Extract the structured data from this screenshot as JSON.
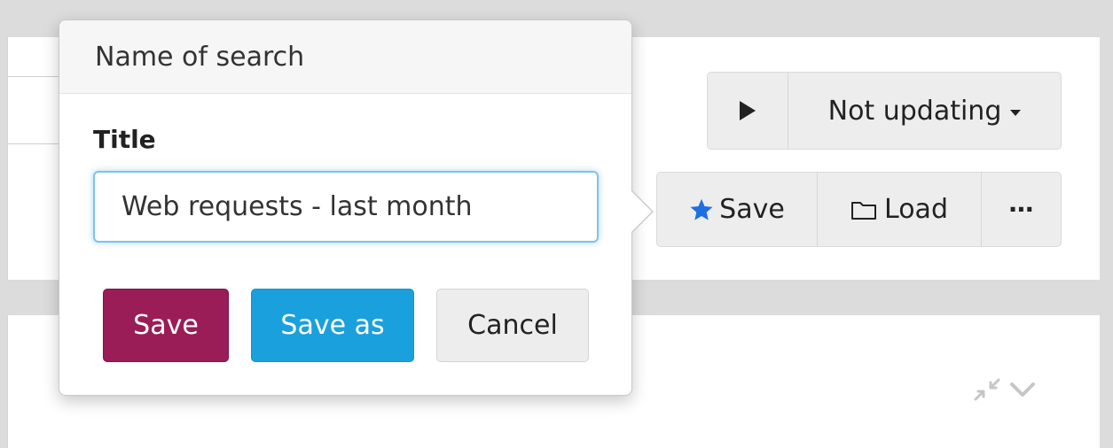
{
  "toolbar": {
    "refresh_status": "Not updating",
    "save_label": "Save",
    "load_label": "Load",
    "more_label": "⋯"
  },
  "popover": {
    "header": "Name of search",
    "field_label": "Title",
    "title_value": "Web requests - last month",
    "save_label": "Save",
    "save_as_label": "Save as",
    "cancel_label": "Cancel"
  },
  "colors": {
    "save_primary": "#9a1d57",
    "save_as": "#1aa0dc",
    "star": "#1f6fe0"
  },
  "icons": [
    "play-icon",
    "caret-down-icon",
    "star-icon",
    "folder-icon",
    "more-icon",
    "compress-icon",
    "chevron-down-icon"
  ]
}
